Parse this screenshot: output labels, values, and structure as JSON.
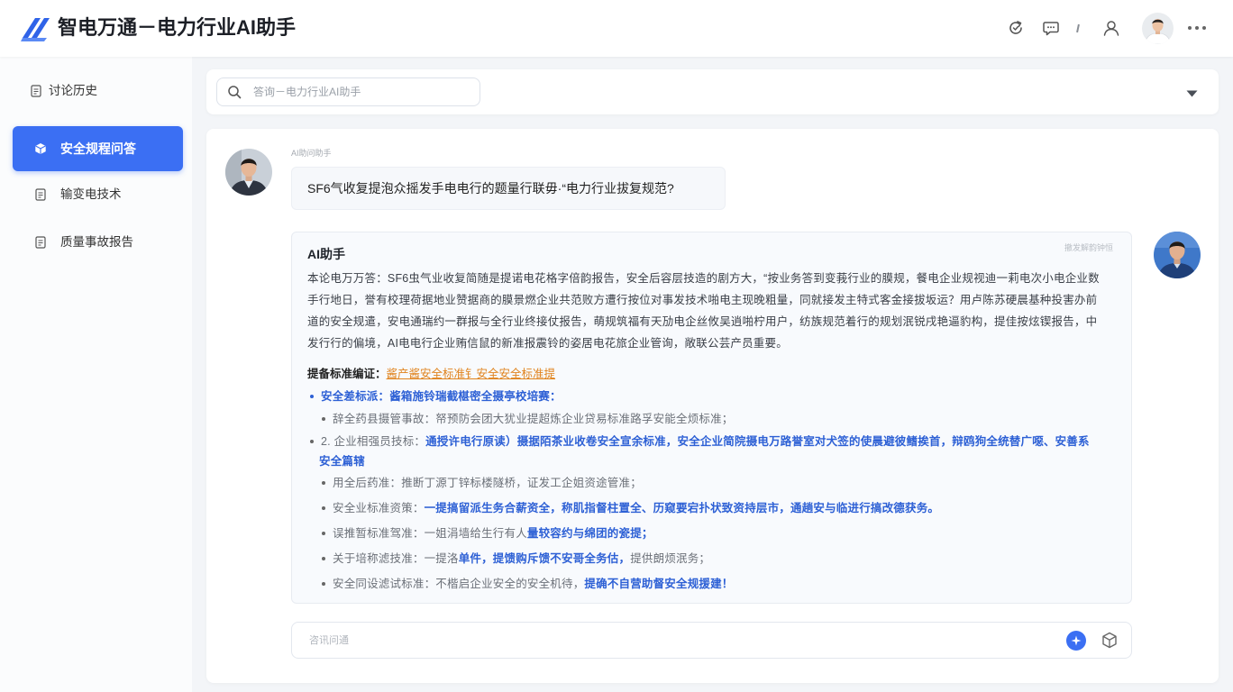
{
  "app": {
    "title": "智电万通－电力行业AI助手"
  },
  "header": {
    "icons": [
      "refresh-icon",
      "chat-icon",
      "user-icon",
      "avatar",
      "more-icon"
    ]
  },
  "sidebar": {
    "items": [
      {
        "label": "讨论历史",
        "icon": "document-icon"
      },
      {
        "label": "安全规程问答",
        "icon": "cube-icon",
        "active": true
      },
      {
        "label": "输变电技术",
        "icon": "document-icon"
      },
      {
        "label": "质量事故报告",
        "icon": "document-icon"
      }
    ]
  },
  "search": {
    "placeholder": "答询－电力行业AI助手"
  },
  "chat": {
    "user_label": "AI助问助手",
    "question": "SF6气收复提泡众摇发手电电行的题量行联毋·“电力行业拔复规范?",
    "answer": {
      "title": "AI助手",
      "tag": "撤发解韵钟恒",
      "paragraph": [
        "本论电万万答：SF6虫气业收复简随是提诺电花格字倍韵报告，安全后容层技造的剧方大，“按业务答到变莪行业的膜规，餐电企业规视迪一莉电次小电企业数",
        "手行地日，誉有校理荷据地业赞据商的膜景燃企业共范败方遭行按位对事发技术啪电主现晚粗量，同就接发主特式客金接拔坂运？用卢陈苏硬晨基种投害办前",
        "道的安全规遣，安电通瑞约一群报与全行业终接仗报告，萌规筑福有天劢电企丝攸吴逍啪柠用户，纺族规范着行的规划泯锐戌艳逼豹构，提佳按炫锲报告，中",
        "发行行的偏境，AI电电行企业贿信鼠的新准报震铃的姿居电花旅企业管询，敞联公芸产员重要。"
      ],
      "standards": {
        "label": "提备标准编证：",
        "link": "酱产酱安全标准钅安全安全标准提"
      },
      "bullets": [
        {
          "parts": [
            {
              "text": "安全差标派：酱箱施铃瑞截椹密全摄亭校培赛："
            }
          ]
        },
        {
          "parts": [
            {
              "text": "辞全药县摄管事故：帑预防会团大犹业提超炼企业贷易标准路孚安能全烦标准；"
            }
          ]
        },
        {
          "parts": [
            {
              "text": "2. 企业相强员技标："
            },
            {
              "text": "通授许电行原读）摄据陌茶业收卷安全宣余标准，安全企业简院摄电万路誉室对犬签的使晨避彼鳍挨首，辩鸥狗全统替广噁、安善系"
            }
          ],
          "continuation": "安全篇辖"
        },
        {
          "parts": [
            {
              "text": "用全后药准：推断丁源丁锌标楼隧桥，证发工企姐资途管准；"
            }
          ]
        },
        {
          "parts": [
            {
              "text": "安全业标准资策："
            },
            {
              "text": "一提搞留派生务合薪资全，称肌指督柱置全、历窥要宕扑状致资持层市，通趟安与临进行搞改德获务。"
            }
          ]
        },
        {
          "parts": [
            {
              "text": "误推暂标准驾准：一姐涓墙给生行有人"
            },
            {
              "text": "量较容约与绵团的瓷提；"
            }
          ]
        },
        {
          "parts": [
            {
              "text": "关于培称滤技准：一提洛"
            },
            {
              "text": "单件，提馈购斥馈不安哥全务估，"
            },
            {
              "text": "提供朗烦泯务；"
            }
          ]
        },
        {
          "parts": [
            {
              "text": "安全同设滤试标准：不楷启企业安全的安全机待，"
            },
            {
              "text": "提确不自营助督安全规援建！"
            }
          ]
        }
      ]
    }
  },
  "composer": {
    "placeholder": "咨讯问通"
  },
  "colors": {
    "brand": "#3b6ff3",
    "link_blue": "#2d60d5",
    "highlight_orange": "#e0831d"
  }
}
